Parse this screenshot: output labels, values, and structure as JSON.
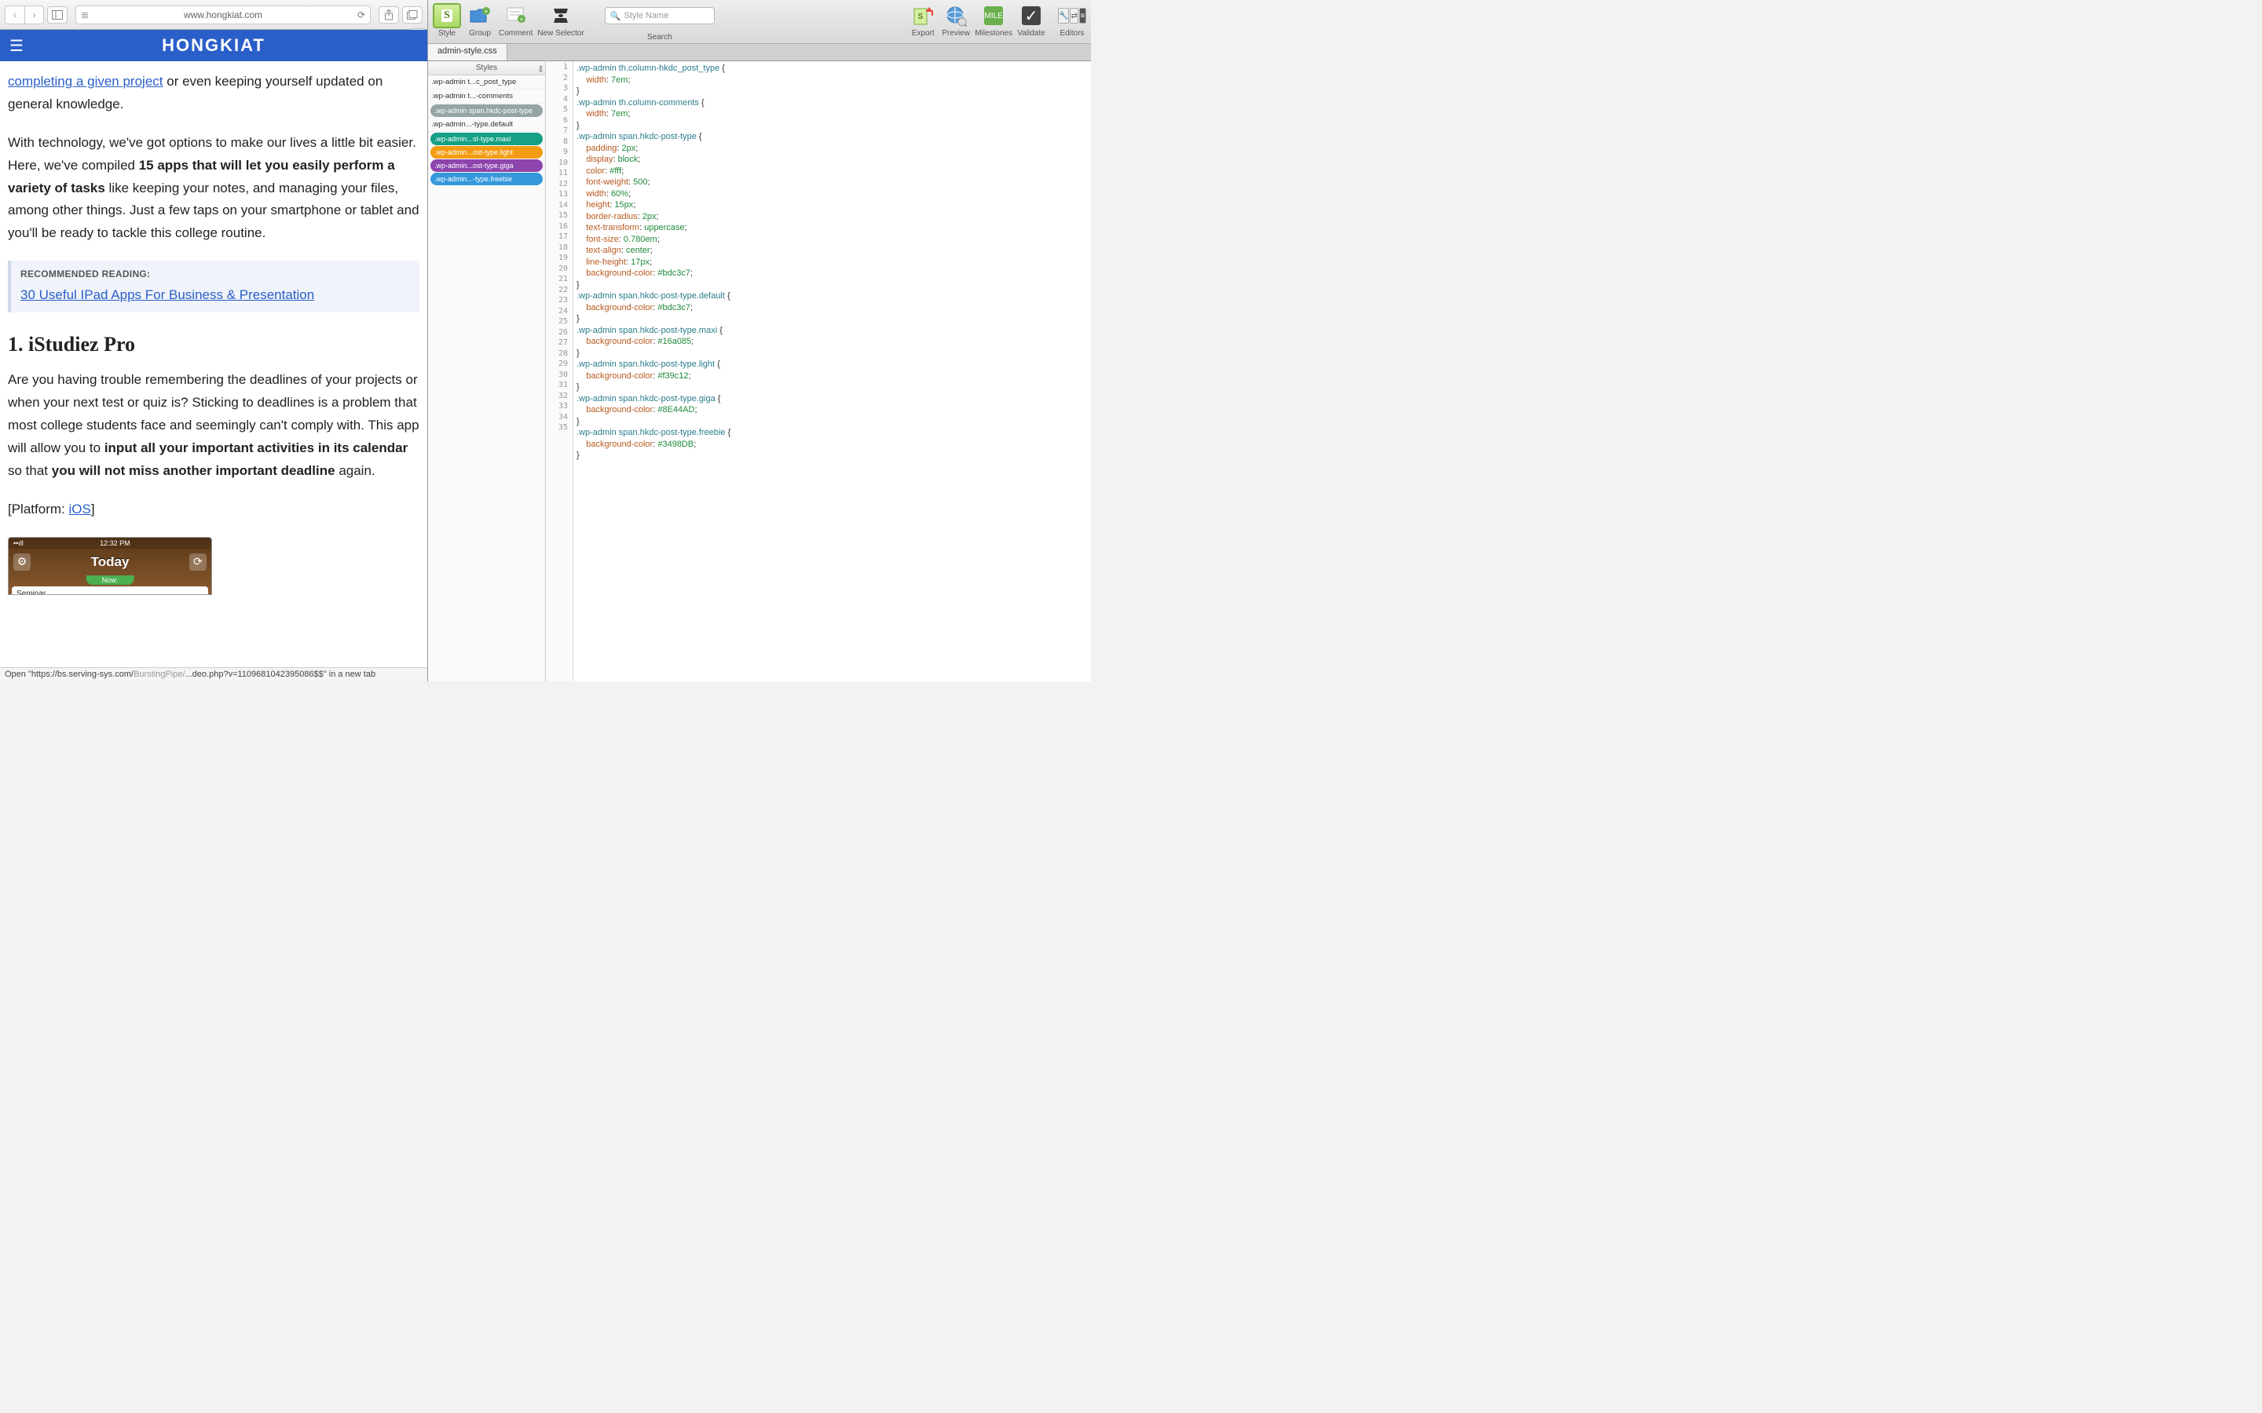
{
  "safari": {
    "url": "www.hongkiat.com",
    "newtab": "+",
    "site_title": "HONGKIAT",
    "para1_link": "completing a given project",
    "para1_rest": " or even keeping yourself updated on general knowledge.",
    "para2_a": "With technology, we've got options to make our lives a little bit easier. Here, we've compiled ",
    "para2_b": "15 apps that will let you easily perform a variety of tasks",
    "para2_c": " like keeping your notes, and managing your files, among other things. Just a few taps on your smartphone or tablet and you'll be ready to tackle this college routine.",
    "reco_title": "RECOMMENDED READING:",
    "reco_link": "30 Useful IPad Apps For Business & Presentation",
    "h2": "1. iStudiez Pro",
    "para3_a": "Are you having trouble remembering the deadlines of your projects or when your next test or quiz is? Sticking to deadlines is a problem that most college students face and seemingly can't comply with. This app will allow you to ",
    "para3_b": "input all your important activities in its calendar",
    "para3_c": " so that ",
    "para3_d": "you will not miss another important deadline",
    "para3_e": " again.",
    "platform_a": "[Platform: ",
    "platform_link": "iOS",
    "platform_b": "]",
    "app_time": "12:32 PM",
    "app_signal": "••ıll",
    "app_wifi": "⌒",
    "app_today": "Today",
    "app_now": "Now:",
    "app_seminar": "Seminar",
    "status_a": "Open \"https://bs.serving-sys.com/",
    "status_b": "BurstingPipe/",
    "status_c": "...deo.php?v=1109681042395086$$\" in a new tab"
  },
  "editor": {
    "toolbar": {
      "style": "Style",
      "group": "Group",
      "comment": "Comment",
      "new_selector": "New Selector",
      "search_placeholder": "Style Name",
      "search_label": "Search",
      "export": "Export",
      "preview": "Preview",
      "milestones": "Milestones",
      "validate": "Validate",
      "editors": "Editors"
    },
    "file_tab": "admin-style.css",
    "styles_header": "Styles",
    "style_items": [
      {
        "label": ".wp-admin t...c_post_type",
        "type": "plain"
      },
      {
        "label": ".wp-admin t...-comments",
        "type": "plain"
      },
      {
        "label": ".wp-admin span.hkdc-post-type",
        "type": "chip",
        "color": "#95a5a6"
      },
      {
        "label": ".wp-admin...-type.default",
        "type": "plain"
      },
      {
        "label": ".wp-admin...st-type.maxi",
        "type": "chip",
        "color": "#16a085"
      },
      {
        "label": ".wp-admin...ost-type.light",
        "type": "chip",
        "color": "#f39c12"
      },
      {
        "label": ".wp-admin...ost-type.giga",
        "type": "chip",
        "color": "#8E44AD"
      },
      {
        "label": ".wp-admin...-type.freebie",
        "type": "chip",
        "color": "#3498DB"
      }
    ],
    "code": [
      {
        "n": 1,
        "t": "sel",
        "s": ".wp-admin th.column-hkdc_post_type",
        "o": " {"
      },
      {
        "n": 2,
        "t": "prop",
        "p": "    width",
        "v": "7em",
        "e": ";"
      },
      {
        "n": 3,
        "t": "close",
        "c": "}"
      },
      {
        "n": 4,
        "t": "sel",
        "s": ".wp-admin th.column-comments",
        "o": " {"
      },
      {
        "n": 5,
        "t": "prop",
        "p": "    width",
        "v": "7em",
        "e": ";"
      },
      {
        "n": 6,
        "t": "close",
        "c": "}"
      },
      {
        "n": 7,
        "t": "sel",
        "s": ".wp-admin span.hkdc-post-type",
        "o": " {"
      },
      {
        "n": 8,
        "t": "prop",
        "p": "    padding",
        "v": "2px",
        "e": ";"
      },
      {
        "n": 9,
        "t": "prop",
        "p": "    display",
        "v": "block",
        "e": ";"
      },
      {
        "n": 10,
        "t": "prop",
        "p": "    color",
        "v": "#fff",
        "e": ";"
      },
      {
        "n": 11,
        "t": "prop",
        "p": "    font-weight",
        "v": "500",
        "e": ";"
      },
      {
        "n": 12,
        "t": "prop",
        "p": "    width",
        "v": "60%",
        "e": ";"
      },
      {
        "n": 13,
        "t": "prop",
        "p": "    height",
        "v": "15px",
        "e": ";"
      },
      {
        "n": 14,
        "t": "prop",
        "p": "    border-radius",
        "v": "2px",
        "e": ";"
      },
      {
        "n": 15,
        "t": "prop",
        "p": "    text-transform",
        "v": "uppercase",
        "e": ";"
      },
      {
        "n": 16,
        "t": "prop",
        "p": "    font-size",
        "v": "0.780em",
        "e": ";"
      },
      {
        "n": 17,
        "t": "prop",
        "p": "    text-align",
        "v": "center",
        "e": ";"
      },
      {
        "n": 18,
        "t": "prop",
        "p": "    line-height",
        "v": "17px",
        "e": ";"
      },
      {
        "n": 19,
        "t": "prop",
        "p": "    background-color",
        "v": "#bdc3c7",
        "e": ";"
      },
      {
        "n": 20,
        "t": "close",
        "c": "}"
      },
      {
        "n": 21,
        "t": "sel",
        "s": ".wp-admin span.hkdc-post-type.default",
        "o": " {"
      },
      {
        "n": 22,
        "t": "prop",
        "p": "    background-color",
        "v": "#bdc3c7",
        "e": ";"
      },
      {
        "n": 23,
        "t": "close",
        "c": "}"
      },
      {
        "n": 24,
        "t": "sel",
        "s": ".wp-admin span.hkdc-post-type.maxi",
        "o": " {"
      },
      {
        "n": 25,
        "t": "prop",
        "p": "    background-color",
        "v": "#16a085",
        "e": ";"
      },
      {
        "n": 26,
        "t": "close",
        "c": "}"
      },
      {
        "n": 27,
        "t": "sel",
        "s": ".wp-admin span.hkdc-post-type.light",
        "o": " {"
      },
      {
        "n": 28,
        "t": "prop",
        "p": "    background-color",
        "v": "#f39c12",
        "e": ";"
      },
      {
        "n": 29,
        "t": "close",
        "c": "}"
      },
      {
        "n": 30,
        "t": "sel",
        "s": ".wp-admin span.hkdc-post-type.giga",
        "o": " {"
      },
      {
        "n": 31,
        "t": "prop",
        "p": "    background-color",
        "v": "#8E44AD",
        "e": ";"
      },
      {
        "n": 32,
        "t": "close",
        "c": "}"
      },
      {
        "n": 33,
        "t": "sel",
        "s": ".wp-admin span.hkdc-post-type.freebie",
        "o": " {"
      },
      {
        "n": 34,
        "t": "prop",
        "p": "    background-color",
        "v": "#3498DB",
        "e": ";"
      },
      {
        "n": 35,
        "t": "close",
        "c": "}"
      }
    ]
  }
}
